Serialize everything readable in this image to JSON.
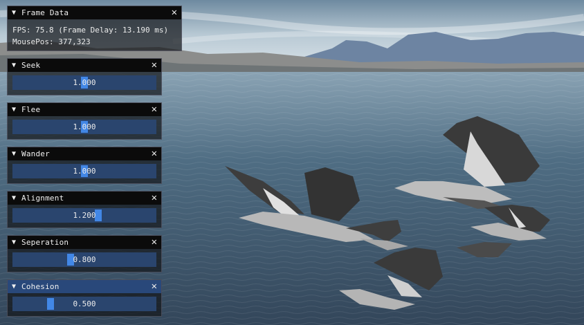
{
  "frame_data": {
    "title": "Frame Data",
    "fps_text": "FPS: 75.8 (Frame Delay: 13.190 ms)",
    "mouse_text": "MousePos: 377,323"
  },
  "panels": [
    {
      "title": "Seek",
      "value": "1.000",
      "fraction": 0.5,
      "active": false
    },
    {
      "title": "Flee",
      "value": "1.000",
      "fraction": 0.5,
      "active": false
    },
    {
      "title": "Wander",
      "value": "1.000",
      "fraction": 0.5,
      "active": false
    },
    {
      "title": "Alignment",
      "value": "1.200",
      "fraction": 0.6,
      "active": false
    },
    {
      "title": "Seperation",
      "value": "0.800",
      "fraction": 0.4,
      "active": false
    },
    {
      "title": "Cohesion",
      "value": "0.500",
      "fraction": 0.25,
      "active": true
    }
  ],
  "icons": {
    "collapse": "collapse-triangle-icon",
    "close": "close-x-icon"
  },
  "colors": {
    "title_active": "#29487a",
    "slider_bg": "#2a456e",
    "grab": "#4287e6",
    "title_bg": "#0b0b0b"
  }
}
